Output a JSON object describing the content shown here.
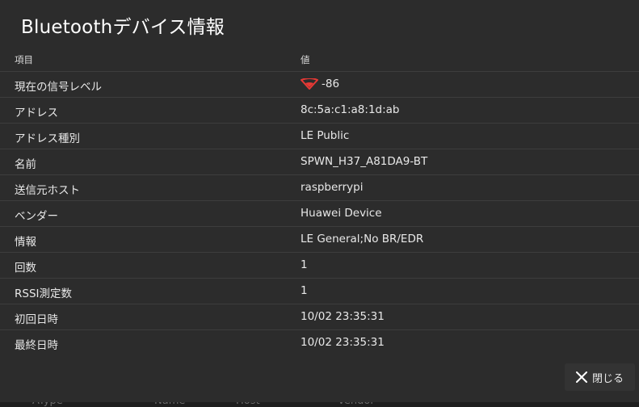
{
  "dialog": {
    "title": "Bluetoothデバイス情報",
    "header": {
      "col_item": "項目",
      "col_value": "値"
    },
    "rows": [
      {
        "label": "現在の信号レベル",
        "value": "-86",
        "icon": "wifi-signal-icon",
        "icon_color": "#e53935"
      },
      {
        "label": "アドレス",
        "value": "8c:5a:c1:a8:1d:ab"
      },
      {
        "label": "アドレス種別",
        "value": "LE Public"
      },
      {
        "label": "名前",
        "value": "SPWN_H37_A81DA9-BT"
      },
      {
        "label": "送信元ホスト",
        "value": "raspberrypi"
      },
      {
        "label": "ベンダー",
        "value": "Huawei Device"
      },
      {
        "label": "情報",
        "value": "LE General;No BR/EDR"
      },
      {
        "label": "回数",
        "value": "1"
      },
      {
        "label": "RSSI測定数",
        "value": "1"
      },
      {
        "label": "初回日時",
        "value": "10/02 23:35:31"
      },
      {
        "label": "最終日時",
        "value": "10/02 23:35:31"
      }
    ],
    "close_label": "閉じる"
  },
  "background_table": {
    "headers": [
      "AType",
      "Name",
      "Host",
      "Vendor"
    ]
  }
}
